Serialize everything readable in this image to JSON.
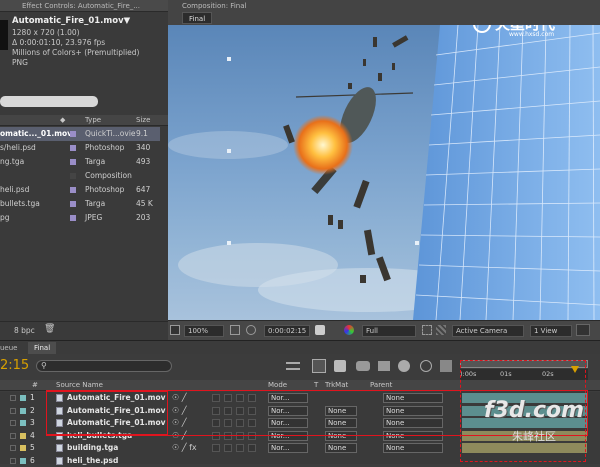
{
  "effect_controls": {
    "tab": "Effect Controls: Automatic_Fire_..."
  },
  "composition": {
    "tab": "Composition: Final",
    "sub_tab": "Final"
  },
  "footage": {
    "name": "Automatic_Fire_01.mov▼",
    "dims": "1280 x 720 (1.00)",
    "duration": "Δ 0:00:01:10, 23.976 fps",
    "colors": "Millions of Colors+ (Premultiplied)",
    "codec": "PNG"
  },
  "project": {
    "col_type": "Type",
    "col_size": "Size",
    "rows": [
      {
        "name": "omatic..._01.mov",
        "type": "QuickTi...ovie",
        "size": "9.1"
      },
      {
        "name": "s/heli.psd",
        "type": "Photoshop",
        "size": "340"
      },
      {
        "name": "ng.tga",
        "type": "Targa",
        "size": "493"
      },
      {
        "name": "",
        "type": "Composition",
        "size": ""
      },
      {
        "name": "heli.psd",
        "type": "Photoshop",
        "size": "647"
      },
      {
        "name": "bullets.tga",
        "type": "Targa",
        "size": "45 K"
      },
      {
        "name": "pg",
        "type": "JPEG",
        "size": "203"
      }
    ],
    "bpc": "8 bpc"
  },
  "viewer": {
    "zoom": "100%",
    "timecode": "0:00:02:15",
    "resolution": "Full",
    "camera": "Active Camera",
    "views": "1 View"
  },
  "timeline": {
    "queue_tab": "ueue",
    "final_tab": "Final",
    "time": "2:15",
    "col_hash": "#",
    "col_source": "Source Name",
    "col_mode": "Mode",
    "col_t": "T",
    "col_trkmat": "TrkMat",
    "col_parent": "Parent",
    "ruler": [
      "):00s",
      "01s",
      "02s"
    ],
    "layers": [
      {
        "num": "1",
        "name": "Automatic_Fire_01.mov",
        "mode": "Nor...",
        "trkmat": "",
        "parent": "None"
      },
      {
        "num": "2",
        "name": "Automatic_Fire_01.mov",
        "mode": "Nor...",
        "trkmat": "None",
        "parent": "None"
      },
      {
        "num": "3",
        "name": "Automatic_Fire_01.mov",
        "mode": "Nor...",
        "trkmat": "None",
        "parent": "None"
      },
      {
        "num": "4",
        "name": "heli_bullets.tga",
        "mode": "Nor...",
        "trkmat": "None",
        "parent": "None"
      },
      {
        "num": "5",
        "name": "building.tga",
        "mode": "Nor...",
        "trkmat": "None",
        "parent": "None"
      },
      {
        "num": "6",
        "name": "heli_the.psd",
        "mode": "",
        "trkmat": "",
        "parent": ""
      }
    ]
  },
  "watermarks": {
    "logo_top": "火星时代",
    "logo_top_url": "www.hxsd.com",
    "logo_bottom": "f3d.com",
    "logo_bottom_sub": "朱峰社区"
  },
  "colors": {
    "accent_orange": "#d8a000",
    "highlight_red": "#e0141e",
    "layer_teal": "#5c8e8e"
  }
}
